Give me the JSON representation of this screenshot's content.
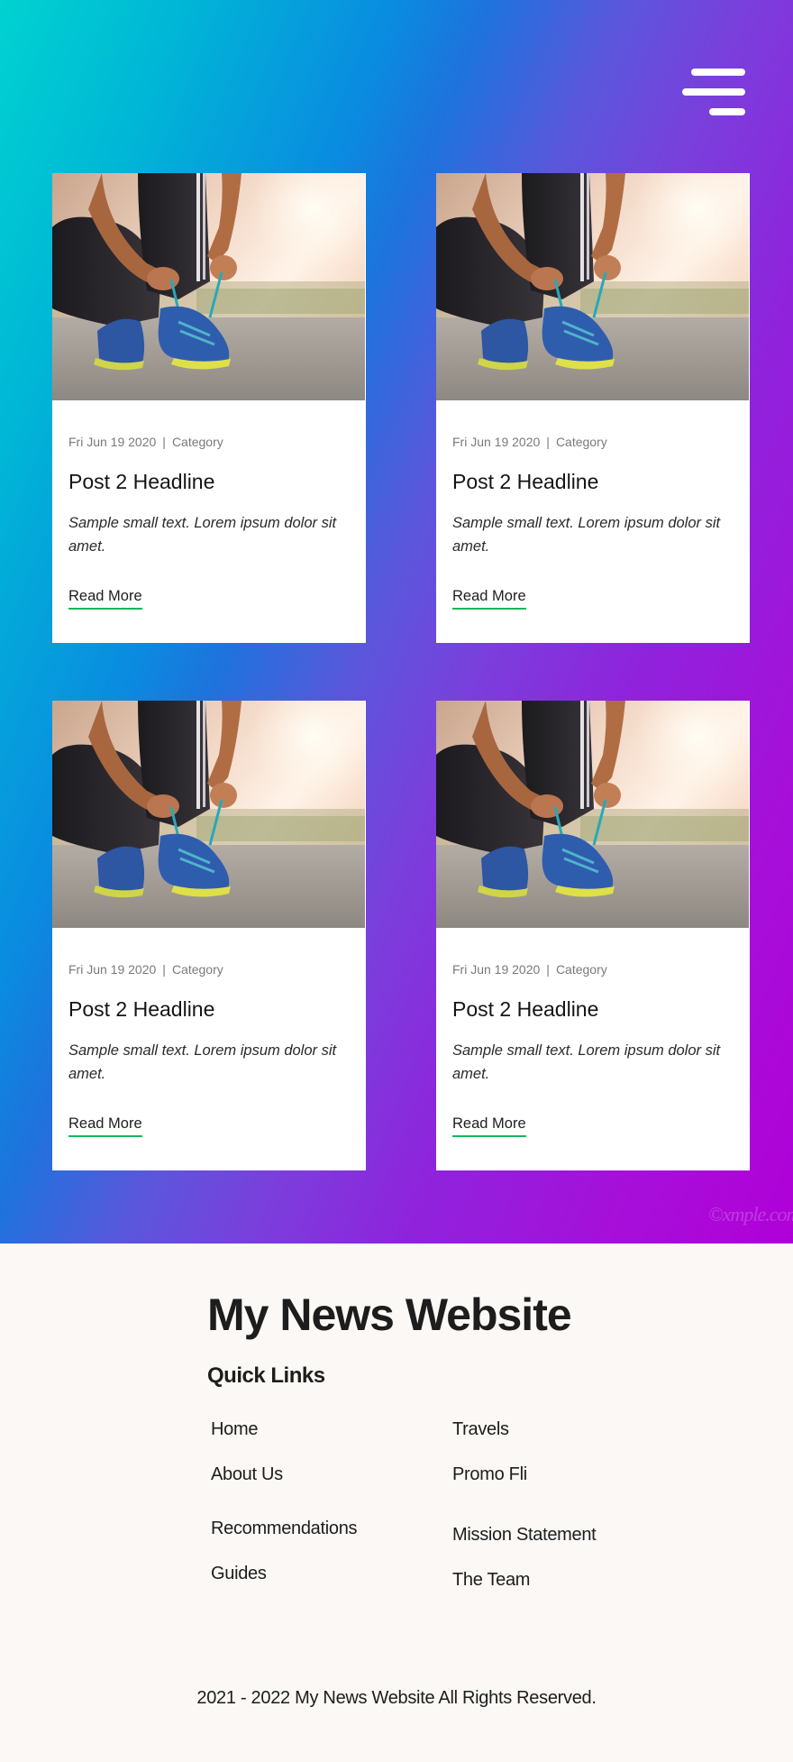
{
  "header": {
    "menu_icon": "hamburger-menu-icon"
  },
  "posts": [
    {
      "date": "Fri Jun 19 2020",
      "separator": "|",
      "category": "Category",
      "headline": "Post 2 Headline",
      "text": "Sample small text. Lorem ipsum dolor sit amet.",
      "link": "Read More"
    },
    {
      "date": "Fri Jun 19 2020",
      "separator": "|",
      "category": "Category",
      "headline": "Post 2 Headline",
      "text": "Sample small text. Lorem ipsum dolor sit amet.",
      "link": "Read More"
    },
    {
      "date": "Fri Jun 19 2020",
      "separator": "|",
      "category": "Category",
      "headline": "Post 2 Headline",
      "text": "Sample small text. Lorem ipsum dolor sit amet.",
      "link": "Read More"
    },
    {
      "date": "Fri Jun 19 2020",
      "separator": "|",
      "category": "Category",
      "headline": "Post 2 Headline",
      "text": "Sample small text. Lorem ipsum dolor sit amet.",
      "link": "Read More"
    }
  ],
  "watermark": "©xmple.com",
  "footer": {
    "title": "My News Website",
    "quick_links_heading": "Quick Links",
    "links": [
      "Home",
      "Travels",
      "About Us",
      "Promo Fli",
      "Recommendations",
      "Mission Statement",
      "Guides",
      "The Team"
    ],
    "copyright": "2021 - 2022 My News Website All Rights Reserved."
  },
  "colors": {
    "accent_underline": "#19b65a",
    "gradient_start": "#00d2d0",
    "gradient_mid": "#0a8be0",
    "gradient_end": "#b000d8",
    "footer_bg": "#fcf8f6"
  }
}
